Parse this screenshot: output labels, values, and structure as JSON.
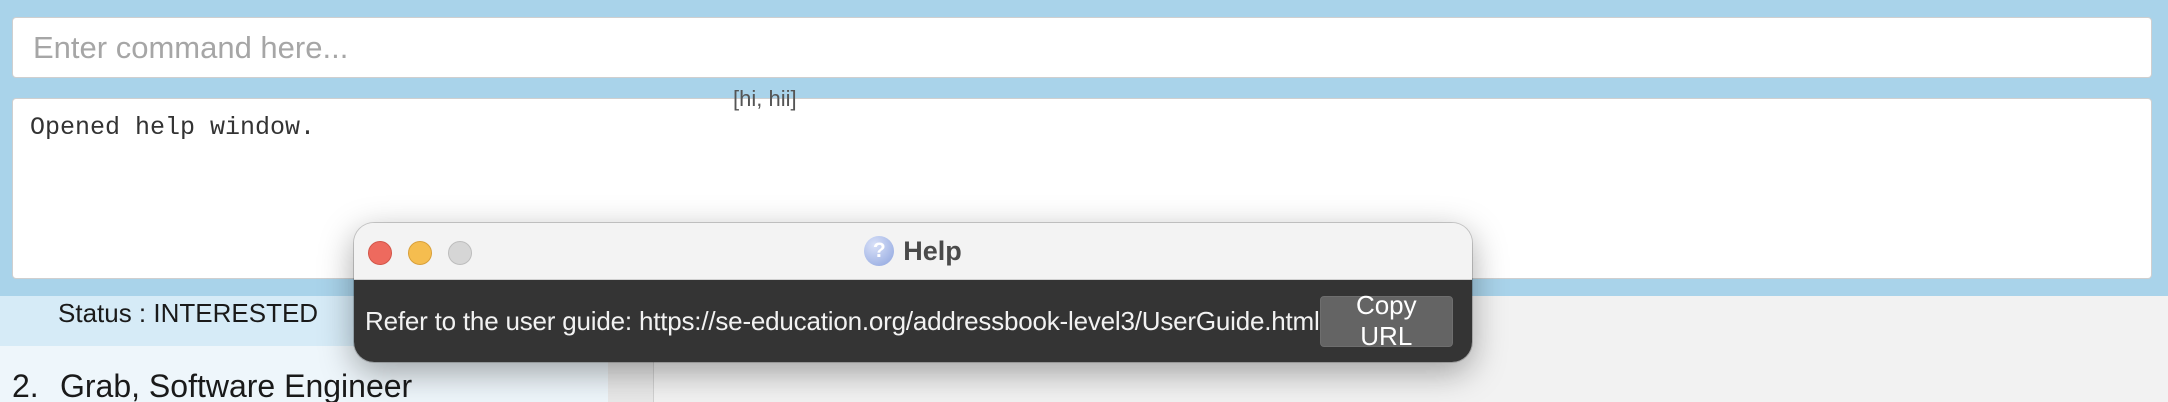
{
  "command": {
    "placeholder": "Enter command here...",
    "value": ""
  },
  "result": {
    "text": "Opened help window."
  },
  "person_list": {
    "status_text": "Status : INTERESTED",
    "item_index": "2.",
    "item_title": "Grab, Software Engineer"
  },
  "detail": {
    "tags": "[hi, hii]"
  },
  "help_window": {
    "title": "Help",
    "icon": "question-mark-icon",
    "message": "Refer to the user guide: https://se-education.org/addressbook-level3/UserGuide.html",
    "copy_button": "Copy URL"
  },
  "colors": {
    "window_bg": "#a9d3ea",
    "close": "#ee6a5e",
    "minimize": "#f5bd4f",
    "zoom": "#d6d6d6",
    "help_body": "#343434",
    "copy_button_bg": "#646464"
  }
}
